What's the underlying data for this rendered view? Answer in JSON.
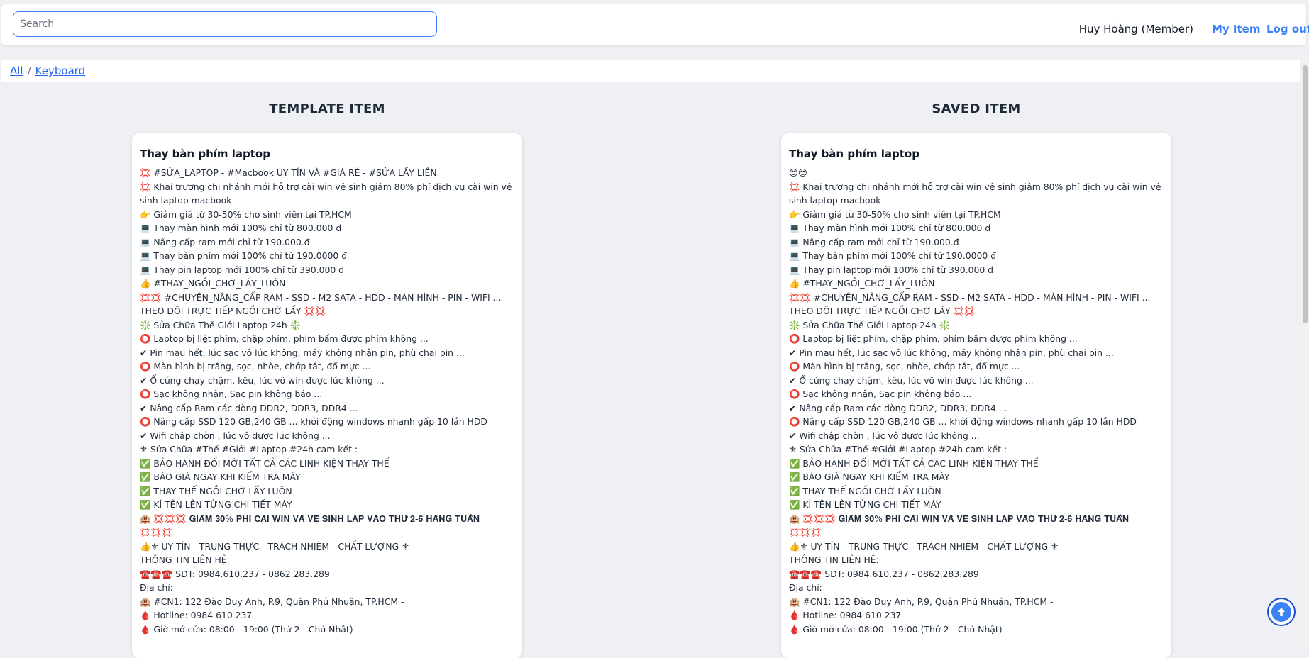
{
  "header": {
    "search_placeholder": "Search",
    "search_value": "",
    "user_label": "Huy Hoàng (Member)",
    "my_item_label": "My Item",
    "logout_label": "Log out"
  },
  "breadcrumb": {
    "root": "All",
    "separator": "/",
    "current": "Keyboard"
  },
  "columns": {
    "template": {
      "heading": "TEMPLATE ITEM",
      "title": "Thay bàn phím laptop",
      "lines": [
        "💢 #SỬA_LAPTOP - #Macbook UY TÍN VÀ #GIÁ RẺ - #SỬA LẤY LIỀN",
        "💢 Khai trương chi nhánh mới hỗ trợ cài win vệ sinh giảm 80% phí dịch vụ cài win vệ sinh laptop macbook",
        "👉 Giảm giá từ 30-50% cho sinh viên tại TP.HCM",
        "💻 Thay màn hình mới 100% chỉ từ 800.000 đ",
        "💻 Nâng cấp ram mới chỉ từ 190.000.đ",
        "💻 Thay bàn phím mới 100% chỉ từ 190.0000 đ",
        "💻 Thay pin laptop mới 100% chỉ từ 390.000 đ",
        "👍 #THAY_NGỒI_CHỜ_LẤY_LUÔN",
        "💢💢 #CHUYÊN_NÂNG_CẤP RAM - SSD - M2 SATA - HDD - MÀN HÌNH - PIN - WIFI ... THEO DÕI TRỰC TIẾP NGỒI CHỜ LẤY 💢💢",
        "❇️ Sửa Chữa Thế Giới Laptop 24h ❇️",
        "⭕ Laptop bị liệt phím, chập phím, phím bấm được phím không ...",
        "✔ Pin mau hết, lúc sạc vô lúc không, máy không nhận pin, phù chai pin ...",
        "⭕ Màn hình bị trắng, sọc, nhòe, chớp tắt, đổ mực ...",
        "✔ Ổ cứng chạy chậm, kêu, lúc vô win được lúc không ...",
        "⭕ Sạc không nhận, Sạc pin không báo ...",
        "✔ Nâng cấp Ram các dòng DDR2, DDR3, DDR4 ...",
        "⭕ Nâng cấp SSD 120 GB,240 GB ... khởi động windows nhanh gấp 10 lần HDD",
        "✔ Wifi chập chờn , lúc vô được lúc không ...",
        "⚜ Sửa Chữa #Thế #Giới #Laptop #24h cam kết :",
        "✅ BẢO HÀNH ĐỔI MỚI TẤT CẢ CÁC LINH KIỆN THAY THẾ",
        "✅ BÁO GIÁ NGAY KHI KIỂM TRA MÁY",
        "✅ THAY THẾ NGỒI CHỜ LẤY LUÔN",
        "✅ KÍ TÊN LÊN TỪNG CHI TIẾT MÁY",
        "🏨 💢💢💢 𝐆𝐈𝐀̉𝐌 𝟑𝟎% 𝐏𝐇𝐈́ 𝐂𝐀̀𝐈 𝐖𝐈𝐍 𝐕𝐀̀ 𝐕𝐄̣̂ 𝐒𝐈𝐍𝐇 𝐋𝐀𝐏 𝐕𝐀̀𝐎 𝐓𝐇𝐔̛́ 𝟐-𝟔 𝐇𝐀̀𝐍𝐆 𝐓𝐔𝐀̂̀𝐍 💢💢💢",
        "👍⚜ UY TÍN - TRUNG THỰC - TRÁCH NHIỆM - CHẤT LƯỢNG ⚜",
        "THÔNG TIN LIÊN HỆ:",
        "☎️☎️☎️ SĐT: 0984.610.237 - 0862.283.289",
        "Địa chỉ:",
        "🏨 #CN1: 122 Đào Duy Anh, P.9, Quận Phú Nhuận, TP.HCM -",
        "🩸 Hotline: 0984 610 237",
        "🩸 Giờ mở cửa: 08:00 - 19:00 (Thứ 2 - Chủ Nhật)"
      ]
    },
    "saved": {
      "heading": "SAVED ITEM",
      "title": "Thay bàn phím laptop",
      "lines": [
        "😍😍",
        "💢 Khai trương chi nhánh mới hỗ trợ cài win vệ sinh giảm 80% phí dịch vụ cài win vệ sinh laptop macbook",
        "👉 Giảm giá từ 30-50% cho sinh viên tại TP.HCM",
        "💻 Thay màn hình mới 100% chỉ từ 800.000 đ",
        "💻 Nâng cấp ram mới chỉ từ 190.000.đ",
        "💻 Thay bàn phím mới 100% chỉ từ 190.0000 đ",
        "💻 Thay pin laptop mới 100% chỉ từ 390.000 đ",
        "👍 #THAY_NGỒI_CHỜ_LẤY_LUÔN",
        "💢💢 #CHUYÊN_NÂNG_CẤP RAM - SSD - M2 SATA - HDD - MÀN HÌNH - PIN - WIFI ... THEO DÕI TRỰC TIẾP NGỒI CHỜ LẤY 💢💢",
        "❇️ Sửa Chữa Thế Giới Laptop 24h ❇️",
        "⭕ Laptop bị liệt phím, chập phím, phím bấm được phím không ...",
        "✔ Pin mau hết, lúc sạc vô lúc không, máy không nhận pin, phù chai pin ...",
        "⭕ Màn hình bị trắng, sọc, nhòe, chớp tắt, đổ mực ...",
        "✔ Ổ cứng chạy chậm, kêu, lúc vô win được lúc không ...",
        "⭕ Sạc không nhận, Sạc pin không báo ...",
        "✔ Nâng cấp Ram các dòng DDR2, DDR3, DDR4 ...",
        "⭕ Nâng cấp SSD 120 GB,240 GB ... khởi động windows nhanh gấp 10 lần HDD",
        "✔ Wifi chập chờn , lúc vô được lúc không ...",
        "⚜ Sửa Chữa #Thế #Giới #Laptop #24h cam kết :",
        "✅ BẢO HÀNH ĐỔI MỚI TẤT CẢ CÁC LINH KIỆN THAY THẾ",
        "✅ BÁO GIÁ NGAY KHI KIỂM TRA MÁY",
        "✅ THAY THẾ NGỒI CHỜ LẤY LUÔN",
        "✅ KÍ TÊN LÊN TỪNG CHI TIẾT MÁY",
        "🏨 💢💢💢 𝐆𝐈𝐀̉𝐌 𝟑𝟎% 𝐏𝐇𝐈́ 𝐂𝐀̀𝐈 𝐖𝐈𝐍 𝐕𝐀̀ 𝐕𝐄̣̂ 𝐒𝐈𝐍𝐇 𝐋𝐀𝐏 𝐕𝐀̀𝐎 𝐓𝐇𝐔̛́ 𝟐-𝟔 𝐇𝐀̀𝐍𝐆 𝐓𝐔𝐀̂̀𝐍 💢💢💢",
        "👍⚜ UY TÍN - TRUNG THỰC - TRÁCH NHIỆM - CHẤT LƯỢNG ⚜",
        "THÔNG TIN LIÊN HỆ:",
        "☎️☎️☎️ SĐT: 0984.610.237 - 0862.283.289",
        "Địa chỉ:",
        "🏨 #CN1: 122 Đào Duy Anh, P.9, Quận Phú Nhuận, TP.HCM -",
        "🩸 Hotline: 0984 610 237",
        "🩸 Giờ mở cửa: 08:00 - 19:00 (Thứ 2 - Chủ Nhật)"
      ]
    }
  },
  "icons": {
    "scroll_top": "arrow-up-icon"
  },
  "colors": {
    "accent": "#3b82f6",
    "link": "#2563eb",
    "background": "#eef0f3"
  }
}
